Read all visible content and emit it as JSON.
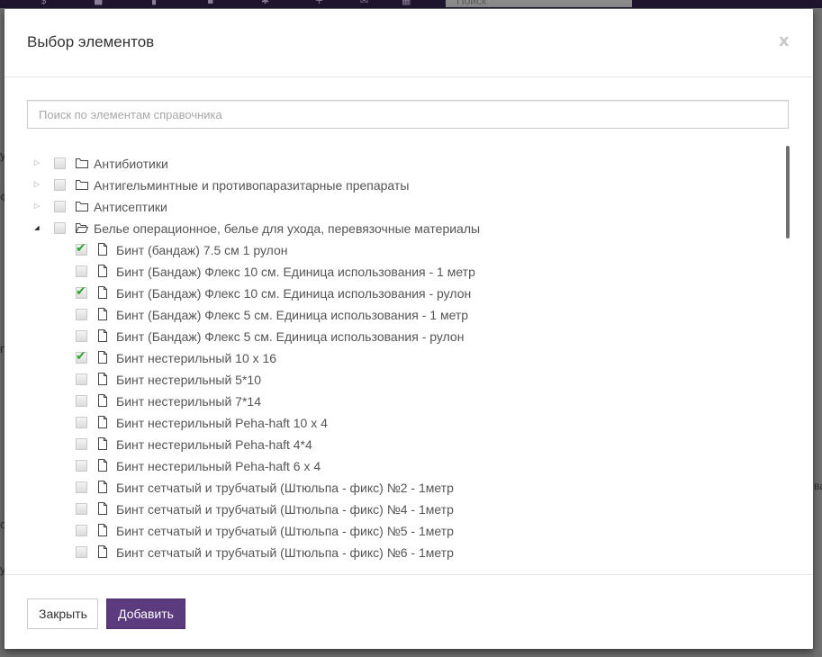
{
  "modal": {
    "title": "Выбор элементов",
    "close_symbol": "x",
    "search_placeholder": "Поиск по элементам справочника",
    "search_value": ""
  },
  "background": {
    "search_placeholder": "Поиск",
    "left_fragments": [
      "у",
      "Ф",
      "п",
      "с",
      "у"
    ],
    "right_fragments": [
      "ва"
    ]
  },
  "tree": {
    "folders": [
      {
        "label": "Антибиотики",
        "expanded": false,
        "checked": false
      },
      {
        "label": "Антигельминтные и противопаразитарные препараты",
        "expanded": false,
        "checked": false
      },
      {
        "label": "Антисептики",
        "expanded": false,
        "checked": false
      },
      {
        "label": "Белье операционное, белье для ухода, перевязочные материалы",
        "expanded": true,
        "checked": false
      }
    ],
    "items": [
      {
        "label": "Бинт (бандаж) 7.5 см 1 рулон",
        "checked": true
      },
      {
        "label": "Бинт (Бандаж) Флекс 10 см. Единица использования - 1 метр",
        "checked": false
      },
      {
        "label": "Бинт (Бандаж) Флекс 10 см. Единица использования - рулон",
        "checked": true
      },
      {
        "label": "Бинт (Бандаж) Флекс 5 см. Единица использования - 1 метр",
        "checked": false
      },
      {
        "label": "Бинт (Бандаж) Флекс 5 см. Единица использования - рулон",
        "checked": false
      },
      {
        "label": "Бинт нестерильный 10 х 16",
        "checked": true
      },
      {
        "label": "Бинт нестерильный 5*10",
        "checked": false
      },
      {
        "label": "Бинт нестерильный 7*14",
        "checked": false
      },
      {
        "label": "Бинт нестерильный Peha-haft 10 x 4",
        "checked": false
      },
      {
        "label": "Бинт нестерильный Peha-haft 4*4",
        "checked": false
      },
      {
        "label": "Бинт нестерильный Peha-haft 6 x 4",
        "checked": false
      },
      {
        "label": "Бинт сетчатый и трубчатый (Штюльпа - фикс) №2 - 1метр",
        "checked": false
      },
      {
        "label": "Бинт сетчатый и трубчатый (Штюльпа - фикс) №4 - 1метр",
        "checked": false
      },
      {
        "label": "Бинт сетчатый и трубчатый (Штюльпа - фикс) №5 - 1метр",
        "checked": false
      },
      {
        "label": "Бинт сетчатый и трубчатый (Штюльпа - фикс) №6 - 1метр",
        "checked": false
      }
    ]
  },
  "footer": {
    "close_label": "Закрыть",
    "add_label": "Добавить"
  },
  "colors": {
    "accent": "#5b3a7e",
    "check": "#2ea42e",
    "overlay": "#6b6b6b"
  },
  "icons": {
    "folder": "folder-icon",
    "folder_open": "folder-open-icon",
    "file": "file-icon",
    "check": "check-icon",
    "expand": "triangle-right-icon",
    "collapse": "triangle-down-icon"
  }
}
